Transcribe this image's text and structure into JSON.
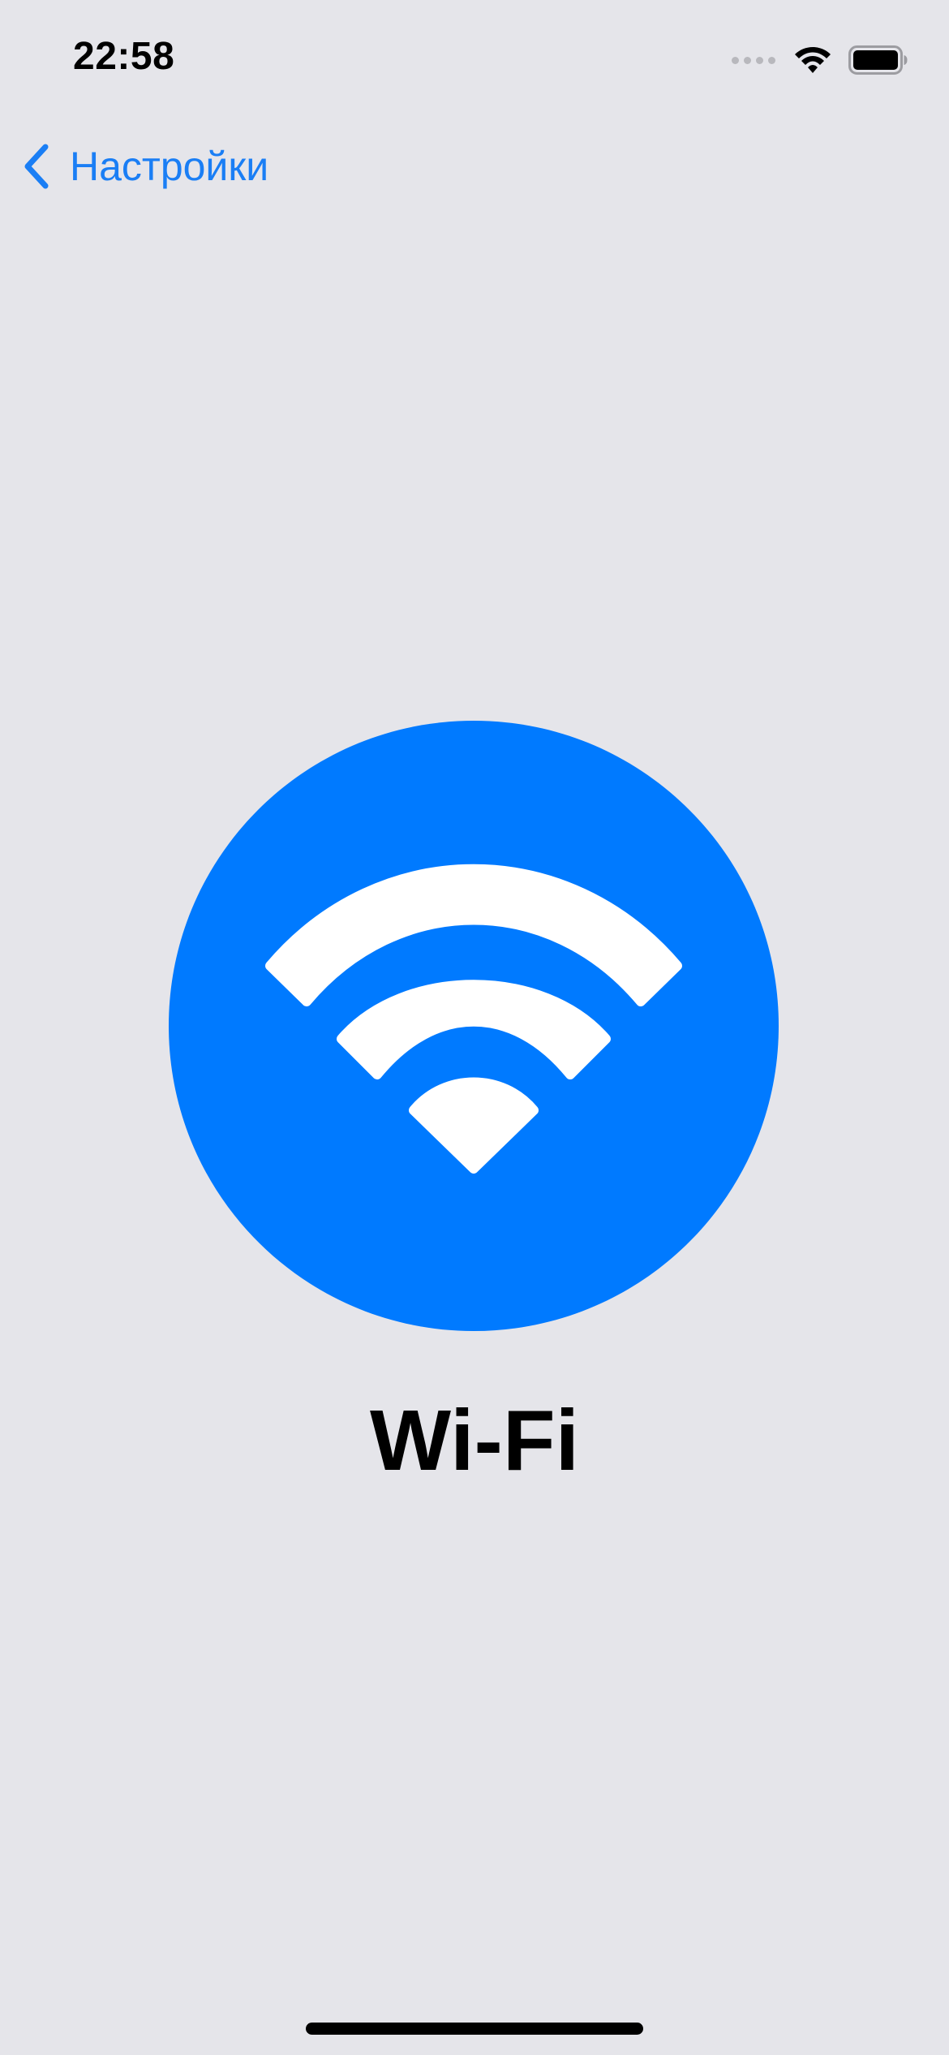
{
  "status_bar": {
    "time": "22:58",
    "signal_icon": "cellular-no-signal-dots",
    "wifi_icon": "wifi-icon",
    "battery_icon": "battery-full-icon"
  },
  "nav": {
    "back_label": "Настройки",
    "back_icon": "chevron-left-icon"
  },
  "hero": {
    "icon": "wifi-icon",
    "title": "Wi-Fi"
  },
  "colors": {
    "background": "#e5e5ea",
    "accent": "#007aff",
    "link": "#1a7ef5"
  }
}
